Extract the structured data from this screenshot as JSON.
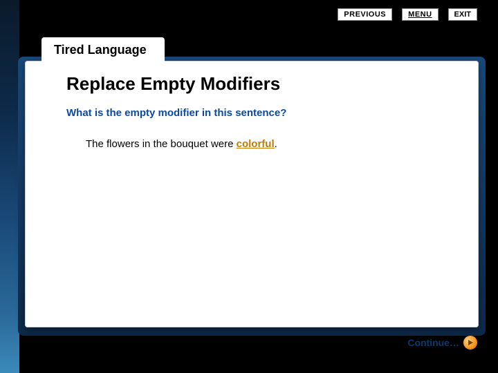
{
  "nav": {
    "previous": "PREVIOUS",
    "menu": "MENU",
    "exit": "EXIT"
  },
  "tab": {
    "label": "Tired Language"
  },
  "content": {
    "heading": "Replace Empty Modifiers",
    "question": "What is the empty modifier in this sentence?",
    "sentence_prefix": "The flowers in the bouquet were ",
    "sentence_highlight": "colorful",
    "sentence_suffix": "."
  },
  "footer": {
    "continue": "Continue…"
  },
  "colors": {
    "question": "#0b4aa0",
    "highlight": "#c27a00",
    "continue_text": "#0b3a6a",
    "arrow_bg": "#f7931e"
  }
}
